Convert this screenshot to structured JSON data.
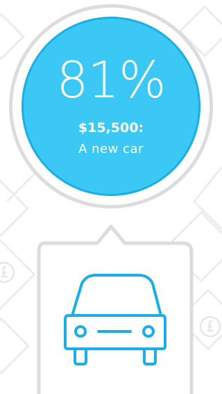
{
  "goal": {
    "percent": "81%",
    "amount": "$15,500:",
    "label": "A new car"
  },
  "icon": "car-icon",
  "colors": {
    "accent": "#3cc8f4",
    "accent_dark": "#19aee6",
    "outline": "#dcdcdc",
    "pattern": "#eeeeee",
    "icon": "#19aee6"
  }
}
